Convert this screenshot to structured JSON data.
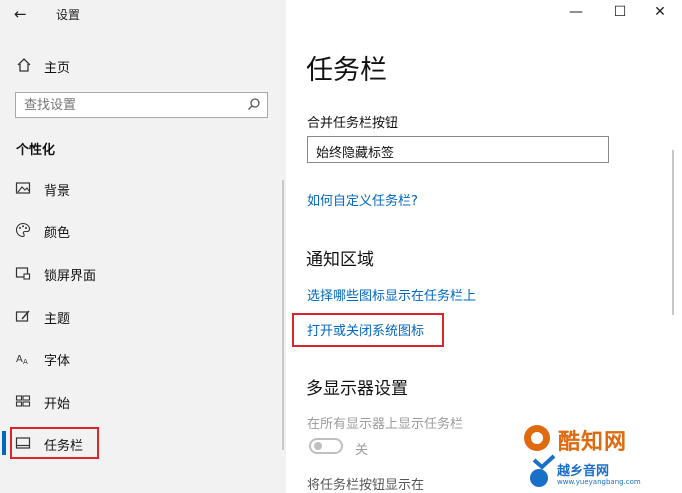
{
  "window": {
    "title": "设置",
    "back_glyph": "←",
    "minimize_glyph": "—",
    "maximize_glyph": "☐",
    "close_glyph": "✕"
  },
  "sidebar": {
    "home_label": "主页",
    "search_placeholder": "查找设置",
    "section_title": "个性化",
    "items": [
      {
        "label": "背景",
        "icon": "image-icon"
      },
      {
        "label": "颜色",
        "icon": "palette-icon"
      },
      {
        "label": "锁屏界面",
        "icon": "lock-screen-icon"
      },
      {
        "label": "主题",
        "icon": "theme-icon"
      },
      {
        "label": "字体",
        "icon": "font-icon"
      },
      {
        "label": "开始",
        "icon": "start-icon"
      },
      {
        "label": "任务栏",
        "icon": "taskbar-icon",
        "selected": true
      }
    ]
  },
  "main": {
    "title": "任务栏",
    "combine_label": "合并任务栏按钮",
    "combine_value": "始终隐藏标签",
    "customize_link": "如何自定义任务栏?",
    "notification_heading": "通知区域",
    "select_icons_link": "选择哪些图标显示在任务栏上",
    "system_icons_link": "打开或关闭系统图标",
    "multi_heading": "多显示器设置",
    "show_all_label": "在所有显示器上显示任务栏",
    "toggle_state": "关",
    "show_buttons_label": "将任务栏按钮显示在"
  },
  "watermark": {
    "brand": "酷知网",
    "sub": "越乡音网",
    "url": "www.yueyangbang.com"
  },
  "colors": {
    "accent": "#0067c0",
    "highlight": "#d9262b",
    "sidebar_bg": "#f2f2f2"
  }
}
